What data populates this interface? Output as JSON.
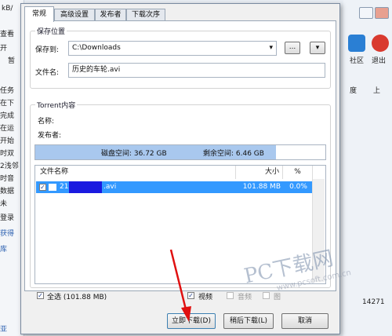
{
  "background": {
    "top_left_text": "kB/",
    "left_items": [
      "查看",
      "开",
      "暂",
      "任务",
      "在下",
      "完成",
      "在运",
      "开始",
      "时双",
      "2浅邻",
      "时音",
      "数据",
      "未",
      "登录",
      "获得",
      "库"
    ],
    "right_toolbar": [
      {
        "label": "社区",
        "icon": "community-icon",
        "color": "#2a7fd4"
      },
      {
        "label": "退出",
        "icon": "exit-icon",
        "color": "#d93a2f"
      }
    ],
    "right_header": [
      "度",
      "上"
    ],
    "status_text": "14271",
    "bottom_left_text": "亚"
  },
  "dialog": {
    "tabs": [
      {
        "label": "常规",
        "active": true
      },
      {
        "label": "高级设置",
        "active": false
      },
      {
        "label": "发布者",
        "active": false
      },
      {
        "label": "下载次序",
        "active": false
      }
    ],
    "save_group": {
      "title": "保存位置",
      "save_to_label": "保存到:",
      "save_path": "C:\\Downloads",
      "browse_button": "...",
      "menu_button": "▾",
      "filename_label": "文件名:",
      "filename": "历史的车轮.avi"
    },
    "torrent_group": {
      "title": "Torrent内容",
      "name_label": "名称:",
      "publisher_label": "发布者:",
      "disk_space": "磁盘空间: 36.72 GB",
      "free_space": "剩余空间: 6.46 GB",
      "disk_used_fraction": 0.83
    },
    "file_table": {
      "columns": [
        "文件名称",
        "大小",
        "%"
      ],
      "rows": [
        {
          "name_prefix": "21",
          "name_suffix": ".avi",
          "size": "101.88 MB",
          "percent": "0.0%",
          "checked": true
        }
      ]
    },
    "select_all": "全选 (101.88 MB)",
    "filters": [
      {
        "label": "视频",
        "checked": true
      },
      {
        "label": "音频",
        "checked": false
      },
      {
        "label": "图",
        "checked": false
      }
    ],
    "buttons": {
      "download_now": "立即下载(D)",
      "download_later": "稍后下载(L)",
      "cancel": "取消"
    }
  },
  "watermark": {
    "main": "PC下载网",
    "sub": "www.pcsoft.com.cn"
  }
}
